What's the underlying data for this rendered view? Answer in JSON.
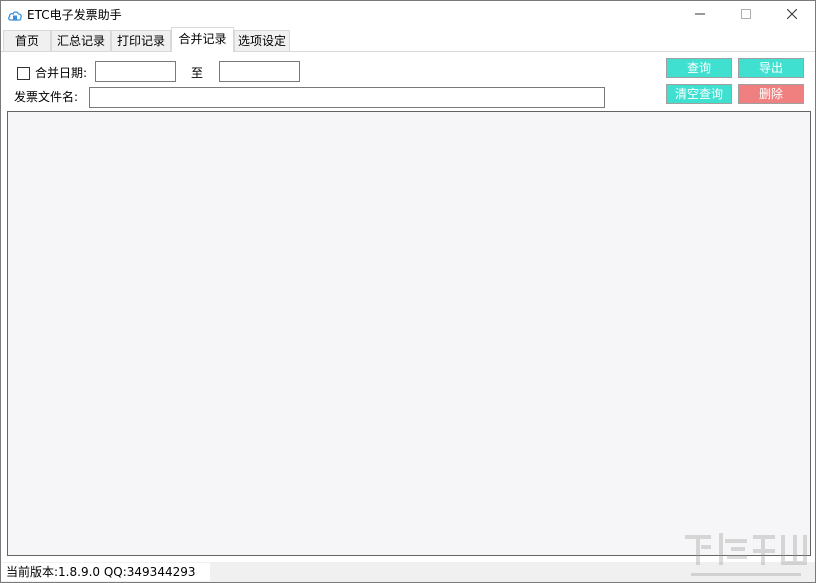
{
  "window": {
    "title": "ETC电子发票助手",
    "app_icon": "cloud-document-icon",
    "controls": [
      "minimize-icon",
      "maximize-icon",
      "close-icon"
    ]
  },
  "tabs": [
    {
      "label": "首页",
      "active": false
    },
    {
      "label": "汇总记录",
      "active": false
    },
    {
      "label": "打印记录",
      "active": false
    },
    {
      "label": "合并记录",
      "active": true
    },
    {
      "label": "选项设定",
      "active": false
    }
  ],
  "filter": {
    "merge_date_label": "合并日期:",
    "merge_date_checked": false,
    "date_from_value": "",
    "to_label": "至",
    "date_to_value": "",
    "filename_label": "发票文件名:",
    "filename_value": ""
  },
  "buttons": {
    "query": "查询",
    "export": "导出",
    "clear_query": "清空查询",
    "delete": "删除"
  },
  "colors": {
    "button_teal": "#40e0d0",
    "button_red": "#f08080",
    "results_background": "#f6f5f8"
  },
  "status": {
    "version_text": "当前版本:1.8.9.0  QQ:349344293"
  }
}
